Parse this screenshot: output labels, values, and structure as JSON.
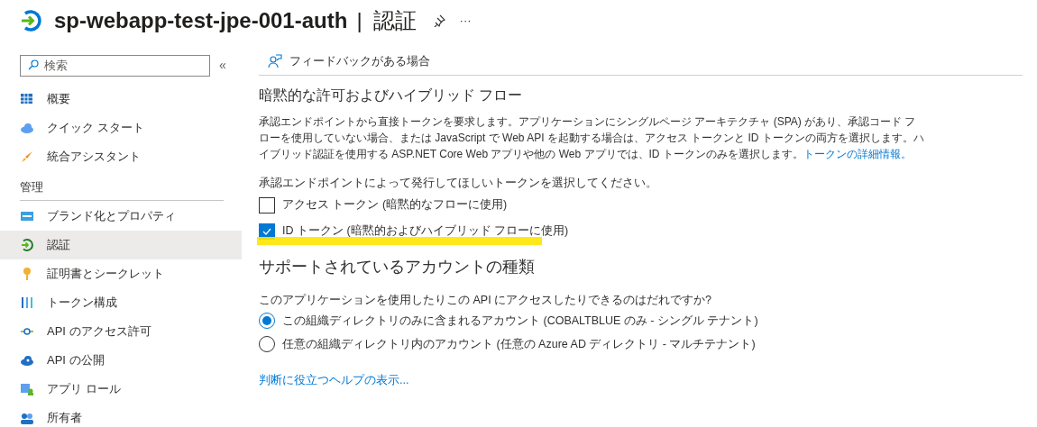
{
  "header": {
    "title": "sp-webapp-test-jpe-001-auth",
    "separator": "|",
    "section": "認証",
    "more": "···"
  },
  "sidebar": {
    "search": {
      "placeholder": "検索"
    },
    "collapse": "«",
    "items": [
      {
        "label": "概要",
        "selected": false
      },
      {
        "label": "クイック スタート",
        "selected": false
      },
      {
        "label": "統合アシスタント",
        "selected": false
      }
    ],
    "group": {
      "label": "管理",
      "items": [
        {
          "label": "ブランド化とプロパティ",
          "selected": false
        },
        {
          "label": "認証",
          "selected": true
        },
        {
          "label": "証明書とシークレット",
          "selected": false
        },
        {
          "label": "トークン構成",
          "selected": false
        },
        {
          "label": "API のアクセス許可",
          "selected": false
        },
        {
          "label": "API の公開",
          "selected": false
        },
        {
          "label": "アプリ ロール",
          "selected": false
        },
        {
          "label": "所有者",
          "selected": false
        }
      ]
    }
  },
  "toolbar": {
    "feedback": "フィードバックがある場合"
  },
  "implicit": {
    "heading": "暗黙的な許可およびハイブリッド フロー",
    "description": "承認エンドポイントから直接トークンを要求します。アプリケーションにシングルページ アーキテクチャ (SPA) があり、承認コード フローを使用していない場合、または JavaScript で Web API を起動する場合は、アクセス トークンと ID トークンの両方を選択します。ハイブリッド認証を使用する ASP.NET Core Web アプリや他の Web アプリでは、ID トークンのみを選択します。",
    "link": "トークンの詳細情報。",
    "prompt": "承認エンドポイントによって発行してほしいトークンを選択してください。",
    "options": [
      {
        "label": "アクセス トークン (暗黙的なフローに使用)",
        "checked": false,
        "highlighted": false
      },
      {
        "label": "ID トークン (暗黙的およびハイブリッド フローに使用)",
        "checked": true,
        "highlighted": true
      }
    ]
  },
  "accounts": {
    "heading": "サポートされているアカウントの種類",
    "prompt": "このアプリケーションを使用したりこの API にアクセスしたりできるのはだれですか?",
    "options": [
      {
        "label": "この組織ディレクトリのみに含まれるアカウント (COBALTBLUE のみ - シングル テナント)",
        "selected": true
      },
      {
        "label": "任意の組織ディレクトリ内のアカウント (任意の Azure AD ディレクトリ - マルチテナント)",
        "selected": false
      }
    ],
    "help": "判断に役立つヘルプの表示..."
  }
}
